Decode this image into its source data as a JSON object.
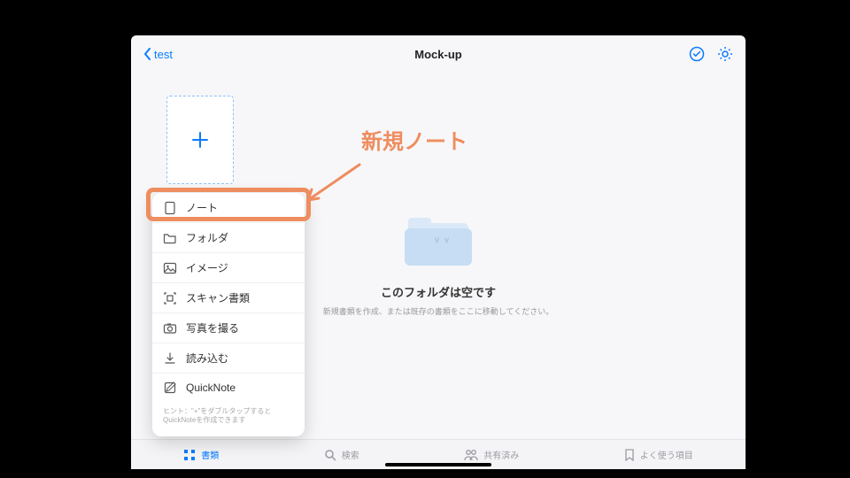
{
  "header": {
    "back_label": "test",
    "title": "Mock-up"
  },
  "empty_state": {
    "heading": "このフォルダは空です",
    "subtext": "新規書類を作成、または既存の書類をここに移動してください。"
  },
  "menu": {
    "items": [
      {
        "label": "ノート",
        "icon": "note-icon"
      },
      {
        "label": "フォルダ",
        "icon": "folder-icon"
      },
      {
        "label": "イメージ",
        "icon": "image-icon"
      },
      {
        "label": "スキャン書類",
        "icon": "scan-icon"
      },
      {
        "label": "写真を撮る",
        "icon": "camera-icon"
      },
      {
        "label": "読み込む",
        "icon": "import-icon"
      },
      {
        "label": "QuickNote",
        "icon": "quicknote-icon"
      }
    ],
    "hint": "ヒント：\"+\"をダブルタップするとQuickNoteを作成できます"
  },
  "annotation": {
    "text": "新規ノート"
  },
  "tabs": {
    "items": [
      {
        "label": "書類",
        "active": true
      },
      {
        "label": "検索",
        "active": false
      },
      {
        "label": "共有済み",
        "active": false
      },
      {
        "label": "よく使う項目",
        "active": false
      }
    ]
  }
}
